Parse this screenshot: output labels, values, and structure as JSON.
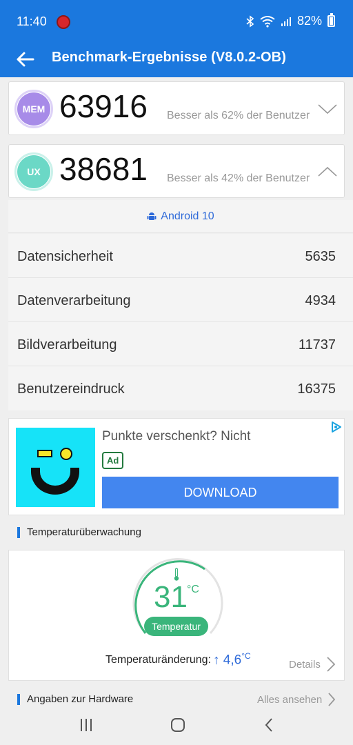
{
  "status_bar": {
    "time": "11:40",
    "battery": "82%",
    "icons": [
      "notification-icon",
      "bluetooth-icon",
      "wifi-icon",
      "signal-icon",
      "battery-icon"
    ]
  },
  "app_bar": {
    "title": "Benchmark-Ergebnisse (V8.0.2-OB)",
    "back_icon": "arrow-left-icon",
    "color": "#1b78de"
  },
  "scores": [
    {
      "badge": "MEM",
      "value": "63916",
      "comparison": "Besser als 62% der Benutzer",
      "expanded": false,
      "color": "#a78be8"
    },
    {
      "badge": "UX",
      "value": "38681",
      "comparison": "Besser als 42% der Benutzer",
      "expanded": true,
      "color": "#6bd8c6"
    }
  ],
  "ux_details": {
    "platform": "Android 10",
    "rows": [
      {
        "label": "Datensicherheit",
        "value": "5635"
      },
      {
        "label": "Datenverarbeitung",
        "value": "4934"
      },
      {
        "label": "Bildverarbeitung",
        "value": "11737"
      },
      {
        "label": "Benutzereindruck",
        "value": "16375"
      }
    ]
  },
  "ad": {
    "headline": "Punkte verschenkt? Nicht",
    "badge": "Ad",
    "button": "DOWNLOAD"
  },
  "temperature": {
    "section_title": "Temperaturüberwachung",
    "value": "31",
    "unit": "°C",
    "pill": "Temperatur",
    "change_label": "Temperaturänderung:",
    "change_value": "↑ 4,6",
    "change_unit": "°C",
    "details": "Details",
    "color": "#3ab57b"
  },
  "hardware": {
    "section_title": "Angaben zur Hardware",
    "see_all": "Alles ansehen"
  }
}
